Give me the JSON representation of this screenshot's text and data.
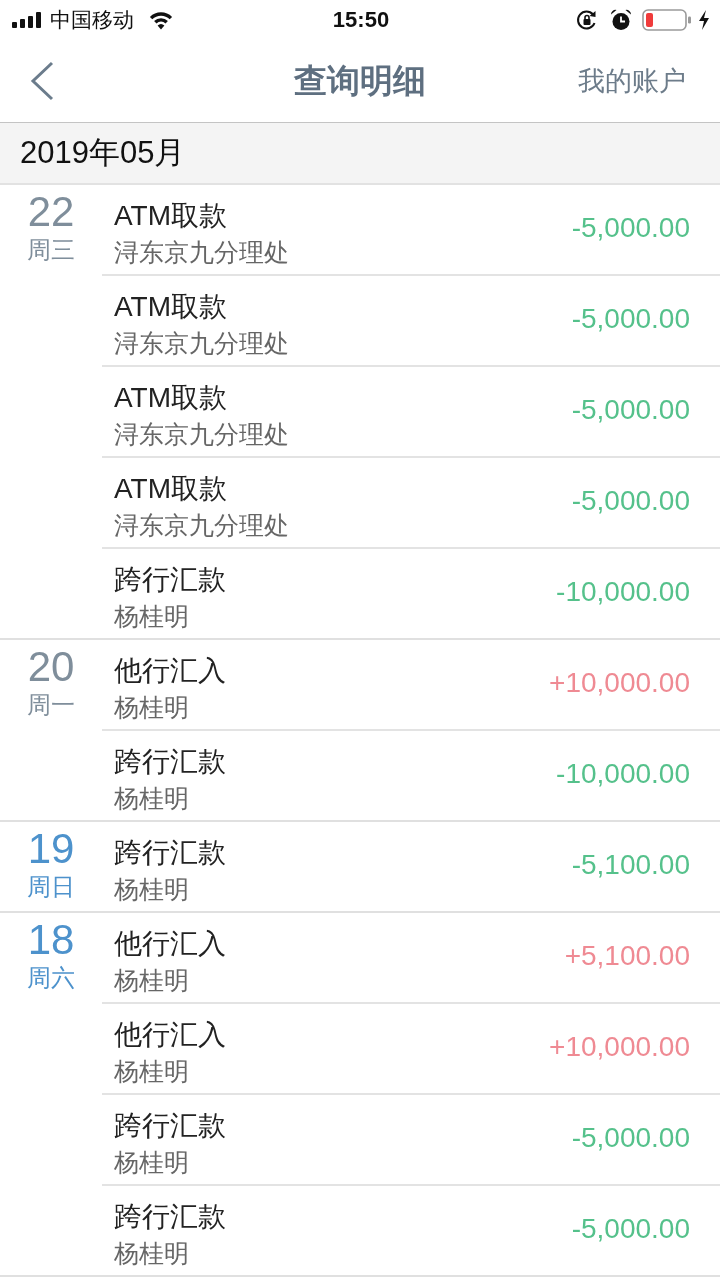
{
  "status_bar": {
    "carrier": "中国移动",
    "time": "15:50"
  },
  "nav_bar": {
    "title": "查询明细",
    "right_action": "我的账户"
  },
  "month_header": "2019年05月",
  "days": [
    {
      "day": "22",
      "weekday": "周三",
      "color": "#7f8e9b",
      "transactions": [
        {
          "title": "ATM取款",
          "subtitle": "浔东京九分理处",
          "amount": "-5,000.00",
          "kind": "debit"
        },
        {
          "title": "ATM取款",
          "subtitle": "浔东京九分理处",
          "amount": "-5,000.00",
          "kind": "debit"
        },
        {
          "title": "ATM取款",
          "subtitle": "浔东京九分理处",
          "amount": "-5,000.00",
          "kind": "debit"
        },
        {
          "title": "ATM取款",
          "subtitle": "浔东京九分理处",
          "amount": "-5,000.00",
          "kind": "debit"
        },
        {
          "title": "跨行汇款",
          "subtitle": "杨桂明",
          "amount": "-10,000.00",
          "kind": "debit"
        }
      ]
    },
    {
      "day": "20",
      "weekday": "周一",
      "color": "#7f8e9b",
      "transactions": [
        {
          "title": "他行汇入",
          "subtitle": "杨桂明",
          "amount": "+10,000.00",
          "kind": "credit"
        },
        {
          "title": "跨行汇款",
          "subtitle": "杨桂明",
          "amount": "-10,000.00",
          "kind": "debit"
        }
      ]
    },
    {
      "day": "19",
      "weekday": "周日",
      "color": "#4d92cc",
      "transactions": [
        {
          "title": "跨行汇款",
          "subtitle": "杨桂明",
          "amount": "-5,100.00",
          "kind": "debit"
        }
      ]
    },
    {
      "day": "18",
      "weekday": "周六",
      "color": "#4d92cc",
      "transactions": [
        {
          "title": "他行汇入",
          "subtitle": "杨桂明",
          "amount": "+5,100.00",
          "kind": "credit"
        },
        {
          "title": "他行汇入",
          "subtitle": "杨桂明",
          "amount": "+10,000.00",
          "kind": "credit"
        },
        {
          "title": "跨行汇款",
          "subtitle": "杨桂明",
          "amount": "-5,000.00",
          "kind": "debit"
        },
        {
          "title": "跨行汇款",
          "subtitle": "杨桂明",
          "amount": "-5,000.00",
          "kind": "debit"
        }
      ]
    }
  ]
}
